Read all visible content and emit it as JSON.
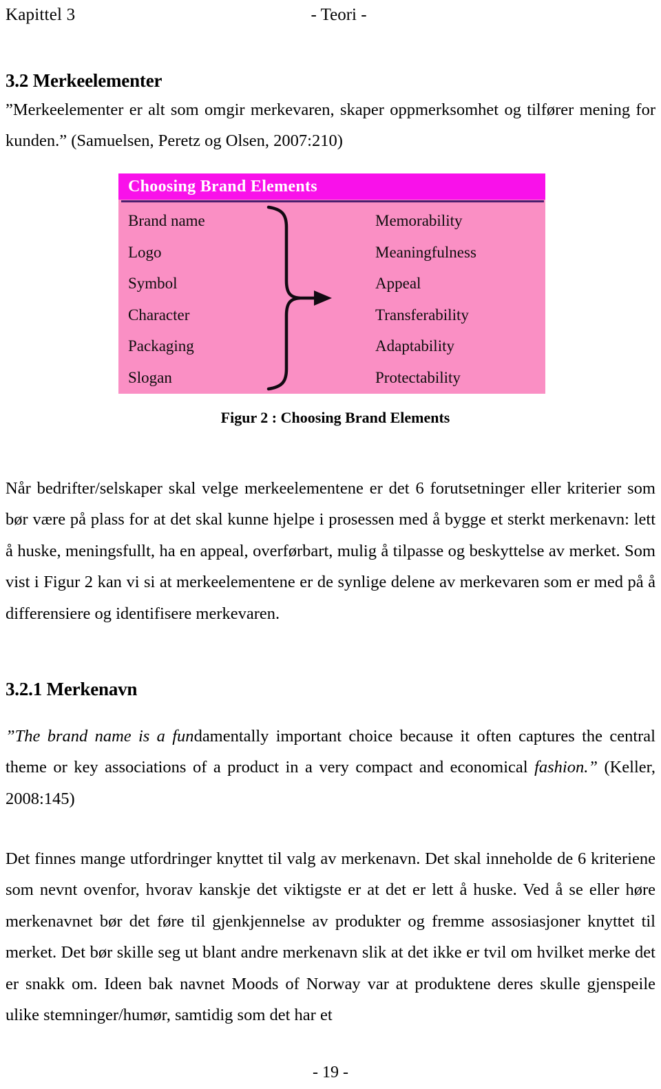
{
  "header": {
    "chapter": "Kapittel 3",
    "running_title": "- Teori -"
  },
  "headings": {
    "section_32": "3.2 Merkeelementer",
    "section_321": "3.2.1 Merkenavn"
  },
  "paragraphs": {
    "intro": "”Merkeelementer er alt som omgir merkevaren, skaper oppmerksomhet og tilfører mening for kunden.” (Samuelsen, Peretz og Olsen, 2007:210)",
    "body1": "Når bedrifter/selskaper skal velge merkeelementene er det 6 forutsetninger eller kriterier som bør være på plass for at det skal kunne hjelpe i prosessen med å bygge et sterkt merkenavn: lett å huske, meningsfullt, ha en appeal, overførbart, mulig å tilpasse og beskyttelse av merket. Som vist i Figur 2 kan vi si at merkeelementene er de synlige delene av merkevaren som er med på å differensiere og identifisere merkevaren.",
    "quote_italic_1": "”The brand name is a fun",
    "quote_roman_1": "damentally important choice because it often captures the central theme or key associations of a product in a very compact and economical ",
    "quote_italic_2": "fashion.”",
    "quote_roman_2": " (Keller, 2008:145)",
    "body2": "Det finnes mange utfordringer knyttet til valg av merkenavn. Det skal inneholde de 6 kriteriene som nevnt ovenfor, hvorav kanskje det viktigste er at det er lett å huske. Ved å se eller høre merkenavnet bør det føre til gjenkjennelse av produkter og fremme assosiasjoner knyttet til merket. Det bør skille seg ut blant andre merkenavn slik at det ikke er tvil om hvilket merke det er snakk om. Ideen bak navnet Moods of Norway var at produktene deres skulle gjenspeile ulike stemninger/humør, samtidig som det har et"
  },
  "figure": {
    "title": "Choosing Brand Elements",
    "caption": "Figur 2 : Choosing Brand Elements",
    "left_column": [
      "Brand name",
      "Logo",
      "Symbol",
      "Character",
      "Packaging",
      "Slogan"
    ],
    "right_column": [
      "Memorability",
      "Meaningfulness",
      "Appeal",
      "Transferability",
      "Adaptability",
      "Protectability"
    ],
    "connector_icon": "brace-arrow-icon",
    "colors": {
      "title_bar_background": "#f911ea",
      "title_bar_text": "#ffffff",
      "body_background": "#fa8fc4",
      "rule": "#4a1d6e",
      "text": "#0d0d0d"
    }
  },
  "footer": {
    "page_number": "- 19 -"
  }
}
